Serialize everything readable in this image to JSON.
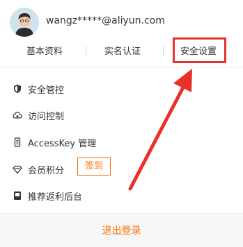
{
  "user": {
    "email": "wangz*****@aliyun.com",
    "avatar_icon": "user-avatar-icon"
  },
  "links": {
    "profile_label": "基本资料",
    "realname_label": "实名认证",
    "security_label": "安全设置"
  },
  "menu": {
    "items": [
      {
        "label": "安全管控",
        "icon": "shield-icon"
      },
      {
        "label": "访问控制",
        "icon": "cloud-icon"
      },
      {
        "label": "AccessKey 管理",
        "icon": "key-icon"
      },
      {
        "label": "会员积分",
        "icon": "diamond-icon",
        "badge": "签到"
      },
      {
        "label": "推荐返利后台",
        "icon": "document-icon"
      }
    ]
  },
  "footer": {
    "logout_label": "退出登录"
  },
  "colors": {
    "accent": "#ff6a00",
    "annotation": "#e8312a"
  }
}
